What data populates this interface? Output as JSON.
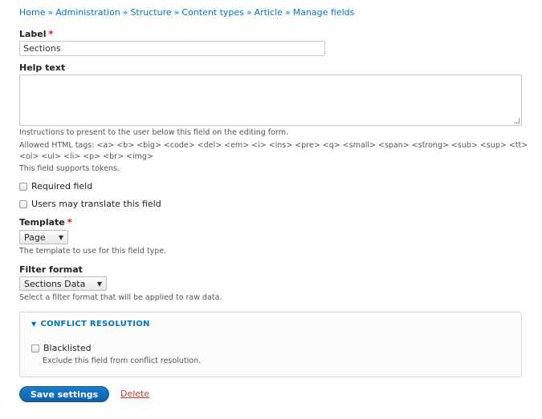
{
  "breadcrumb": [
    "Home",
    "Administration",
    "Structure",
    "Content types",
    "Article",
    "Manage fields"
  ],
  "breadcrumb_sep": "»",
  "label_field": {
    "label": "Label",
    "required_mark": "*",
    "value": "Sections"
  },
  "help_text": {
    "label": "Help text",
    "value": "",
    "desc_1": "Instructions to present to the user below this field on the editing form.",
    "desc_2": "Allowed HTML tags: <a> <b> <big> <code> <del> <em> <i> <ins> <pre> <q> <small> <span> <strong> <sub> <sup> <tt>",
    "desc_3": "<ol> <ul> <li> <p> <br> <img>",
    "desc_4": "This field supports tokens."
  },
  "required_field": {
    "label": "Required field",
    "checked": false
  },
  "translate_field": {
    "label": "Users may translate this field",
    "checked": false
  },
  "template": {
    "label": "Template",
    "required_mark": "*",
    "selected": "Page",
    "desc": "The template to use for this field type."
  },
  "filter_format": {
    "label": "Filter format",
    "selected": "Sections Data",
    "desc": "Select a filter format that will be applied to raw data."
  },
  "conflict_resolution": {
    "title": "CONFLICT RESOLUTION",
    "blacklisted_label": "Blacklisted",
    "blacklisted_desc": "Exclude this field from conflict resolution.",
    "checked": false
  },
  "actions": {
    "save_label": "Save settings",
    "delete_label": "Delete"
  },
  "colors": {
    "link": "#0074bd",
    "primary": "#0f5fa8",
    "required": "#e00000",
    "delete": "#c0392b"
  },
  "icons": {
    "disclosure": "triangle-down-icon",
    "select_arrow": "chevron-down-icon"
  }
}
